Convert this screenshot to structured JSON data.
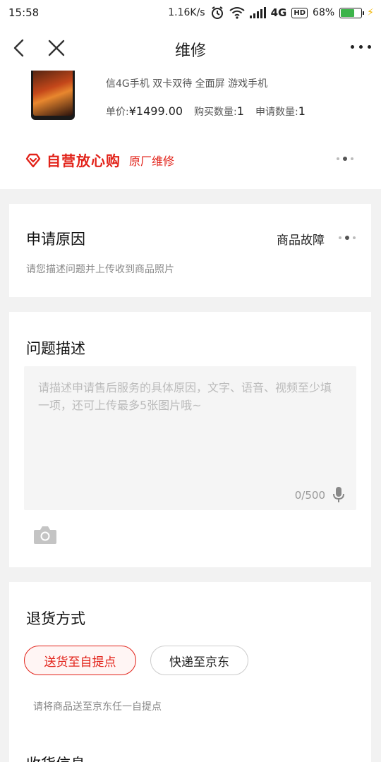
{
  "status": {
    "time": "15:58",
    "speed": "1.16K/s",
    "network": "4G",
    "hd": "HD",
    "battery": "68%"
  },
  "nav": {
    "title": "维修"
  },
  "product": {
    "name": "信4G手机 双卡双待 全面屏 游戏手机",
    "price_label": "单价:",
    "price": "¥1499.00",
    "buy_qty_label": "购买数量:",
    "buy_qty": "1",
    "apply_qty_label": "申请数量:",
    "apply_qty": "1",
    "badge": "自营放心购",
    "badge_sub": "原厂维修"
  },
  "reason": {
    "title": "申请原因",
    "value": "商品故障",
    "hint": "请您描述问题并上传收到商品照片"
  },
  "description": {
    "title": "问题描述",
    "placeholder": "请描述申请售后服务的具体原因，文字、语音、视频至少填一项，还可上传最多5张图片哦~",
    "count": "0/500"
  },
  "return_method": {
    "title": "退货方式",
    "options": [
      {
        "label": "送货至自提点",
        "selected": true
      },
      {
        "label": "快递至京东",
        "selected": false
      }
    ],
    "hint": "请将商品送至京东任一自提点"
  },
  "next_section": {
    "title": "收货信息"
  },
  "colors": {
    "accent": "#e2231a",
    "background": "#f2f2f2"
  }
}
